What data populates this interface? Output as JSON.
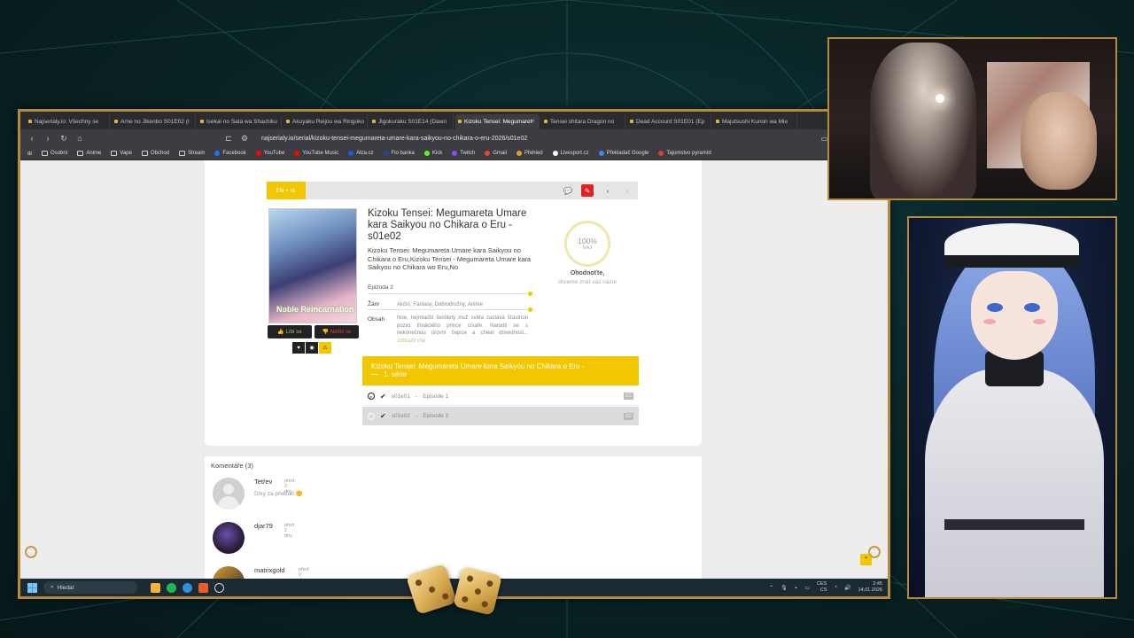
{
  "browser": {
    "tabs": [
      {
        "label": "Najserialy.io: Všechny se"
      },
      {
        "label": "Arne no Jikenbo S01E02 (I"
      },
      {
        "label": "Isekai no Sata wa Shachiku"
      },
      {
        "label": "Akuyaku Reijou wa Ringoko"
      },
      {
        "label": "Jigokuraku S01E14 (Dawn"
      },
      {
        "label": "Kizoku Tensei: Megumaret"
      },
      {
        "label": "Tensei shitara Dragon no"
      },
      {
        "label": "Dead Account S01E01 (Ep"
      },
      {
        "label": "Majutsushi Kunon wa Mie"
      }
    ],
    "active_tab_index": 5,
    "url": "najserialy.io/serial/kizoku-tensei-megumareta-umare-kara-saikyou-no-chikara-o-eru-2026/s01e02",
    "bookmarks": [
      {
        "label": "Osobní",
        "icon": "folder-icon"
      },
      {
        "label": "Anime",
        "icon": "folder-icon"
      },
      {
        "label": "Vape",
        "icon": "folder-icon"
      },
      {
        "label": "Obchod",
        "icon": "folder-icon"
      },
      {
        "label": "Stream",
        "icon": "folder-icon"
      },
      {
        "label": "Facebook",
        "icon": "facebook-icon",
        "color": "#1877f2"
      },
      {
        "label": "YouTube",
        "icon": "youtube-icon",
        "color": "#ff0000"
      },
      {
        "label": "YouTube Music",
        "icon": "youtube-music-icon",
        "color": "#ff0000"
      },
      {
        "label": "Alza.cz",
        "icon": "alza-icon",
        "color": "#1a5bd8"
      },
      {
        "label": "Fio banka",
        "icon": "fio-icon",
        "color": "#1f4a8a"
      },
      {
        "label": "Kick",
        "icon": "kick-icon",
        "color": "#53fc18"
      },
      {
        "label": "Twitch",
        "icon": "twitch-icon",
        "color": "#9146ff"
      },
      {
        "label": "Gmail",
        "icon": "gmail-icon",
        "color": "#ea4335"
      },
      {
        "label": "Přehled",
        "icon": "overview-icon",
        "color": "#e0a020"
      },
      {
        "label": "Livesport.cz",
        "icon": "livesport-icon",
        "color": "#ffffff"
      },
      {
        "label": "Překladač Google",
        "icon": "google-translate-icon",
        "color": "#4285f4"
      },
      {
        "label": "Tajomstvo pyramíd",
        "icon": "m-icon",
        "color": "#e53935"
      }
    ]
  },
  "page": {
    "lang_button": "EN + tit.",
    "title": "Kizoku Tensei: Megumareta Umare kara Saikyou no Chikara o Eru - s01e02",
    "alt_names": "Kizoku Tensei: Megumareta Umare kara Saikyou no Chikara o Eru,Kizoku Tensei - Megumareta Umare kara Saikyou no Chikara wo Eru,No",
    "episode_label": "Epizoda 2",
    "genre_key": "Žánr",
    "genre_value": "Akční, Fantasy, Dobrodružný, Anime",
    "plot_key": "Obsah",
    "plot_value": "Noe, nejmladší šestiletý muž světa zastává šťastnou pozici třináctého prince císaře. Narodil se s nekonečnou úrovní čepice a cheat dovednost...",
    "plot_more": "zobrazit vše",
    "like_label": "Líbí se",
    "dislike_label": "Nelíbí se",
    "poster_title": "Noble Reincarnation",
    "rating": {
      "percent": "100%",
      "sub": "NAJ",
      "cta": "Ohodnoťte,",
      "cta_sub": "chceme znát váš názor"
    },
    "season_title": "Kizoku Tensei: Megumareta Umare kara Saikyou no Chikara o Eru -",
    "season_sub": "1. série",
    "episodes": [
      {
        "code": "s01e01",
        "name": "Episode 1",
        "cc": "CC"
      },
      {
        "code": "s01e02",
        "name": "Episode 2",
        "cc": "CC"
      }
    ]
  },
  "comments": {
    "header": "Komentáře (3)",
    "items": [
      {
        "name": "Tetřev",
        "time": "před 2 dny",
        "text": "Díky za překlad 🙂"
      },
      {
        "name": "djar79",
        "time": "před 2 dny",
        "text": ""
      },
      {
        "name": "matrixgold",
        "time": "před 2 dny",
        "text": ""
      }
    ]
  },
  "taskbar": {
    "search_placeholder": "Hledat",
    "lang": "CES",
    "lang_sub": "CS",
    "time": "2:45",
    "date": "14.01.2026"
  },
  "colors": {
    "accent_yellow": "#f2c600",
    "frame_gold": "#b58a3c",
    "stream_bg": "#0a2627"
  }
}
